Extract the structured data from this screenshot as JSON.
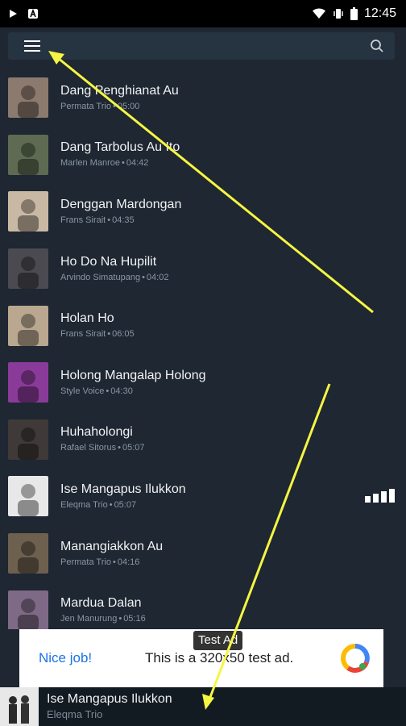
{
  "status_bar": {
    "time": "12:45",
    "icons": [
      "play-icon",
      "notification-a-icon",
      "wifi-icon",
      "vibrate-icon",
      "battery-icon"
    ]
  },
  "top_bar": {
    "menu_icon": "hamburger-menu-icon",
    "search_icon": "search-icon"
  },
  "songs": [
    {
      "title": "Dang Penghianat Au",
      "artist": "Permata Trio",
      "duration": "05:00",
      "thumb_color": "#8c7a6e"
    },
    {
      "title": "Dang Tarbolus Au Ito",
      "artist": "Marlen Manroe",
      "duration": "04:42",
      "thumb_color": "#5e6b52"
    },
    {
      "title": "Denggan Mardongan",
      "artist": "Frans Sirait",
      "duration": "04:35",
      "thumb_color": "#c9b9a4"
    },
    {
      "title": "Ho Do Na Hupilit",
      "artist": "Arvindo Simatupang",
      "duration": "04:02",
      "thumb_color": "#4b4a50"
    },
    {
      "title": "Holan Ho",
      "artist": "Frans Sirait",
      "duration": "06:05",
      "thumb_color": "#b9a78f"
    },
    {
      "title": "Holong Mangalap Holong",
      "artist": "Style Voice",
      "duration": "04:30",
      "thumb_color": "#8a3b9a"
    },
    {
      "title": "Huhaholongi",
      "artist": "Rafael Sitorus",
      "duration": "05:07",
      "thumb_color": "#3f3a38"
    },
    {
      "title": "Ise Mangapus Ilukkon",
      "artist": "Eleqma Trio",
      "duration": "05:07",
      "thumb_color": "#e8e8e8",
      "playing": true
    },
    {
      "title": "Manangiakkon Au",
      "artist": "Permata Trio",
      "duration": "04:16",
      "thumb_color": "#6e604f"
    },
    {
      "title": "Mardua Dalan",
      "artist": "Jen Manurung",
      "duration": "05:16",
      "thumb_color": "#7e6a86"
    }
  ],
  "ad": {
    "label": "Test Ad",
    "cta": "Nice job!",
    "text": "This is a 320x50 test ad.",
    "logo_icon": "ad-logo-icon"
  },
  "now_playing": {
    "title": "Ise Mangapus Ilukkon",
    "artist": "Eleqma Trio"
  },
  "colors": {
    "background": "#1e2732",
    "top_bar": "#263341",
    "annotation_arrow": "#f5f542"
  }
}
